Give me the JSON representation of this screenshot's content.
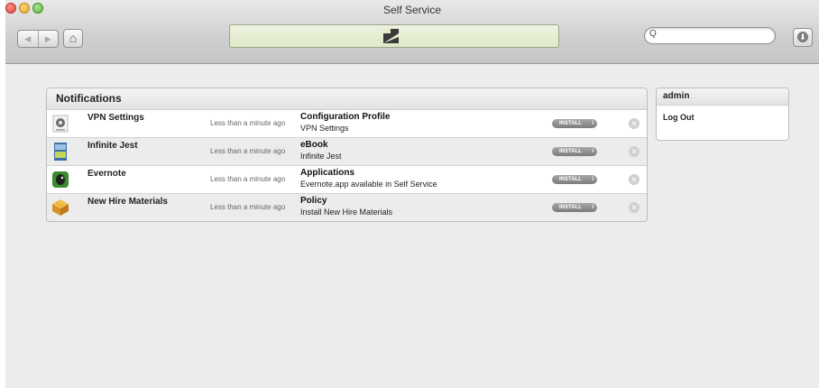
{
  "window": {
    "title": "Self Service"
  },
  "toolbar": {
    "back_glyph": "◀",
    "forward_glyph": "▶",
    "home_glyph": "⌂",
    "search_placeholder": "",
    "search_glyph": "Q",
    "download_glyph": "⬇"
  },
  "notifications": {
    "title": "Notifications",
    "install_label": "INSTALL",
    "info_glyph": "i",
    "dismiss_glyph": "✕",
    "items": [
      {
        "name": "VPN Settings",
        "time": "Less than a minute ago",
        "type": "Configuration Profile",
        "detail": "VPN Settings",
        "icon": "vpn-profile-icon"
      },
      {
        "name": "Infinite Jest",
        "time": "Less than a minute ago",
        "type": "eBook",
        "detail": "Infinite Jest",
        "icon": "ebook-cover-icon"
      },
      {
        "name": "Evernote",
        "time": "Less than a minute ago",
        "type": "Applications",
        "detail": "Evernote.app available in Self Service",
        "icon": "evernote-icon"
      },
      {
        "name": "New Hire Materials",
        "time": "Less than a minute ago",
        "type": "Policy",
        "detail": "Install New Hire Materials",
        "icon": "package-box-icon"
      }
    ]
  },
  "user_panel": {
    "title": "admin",
    "logout_label": "Log Out"
  }
}
